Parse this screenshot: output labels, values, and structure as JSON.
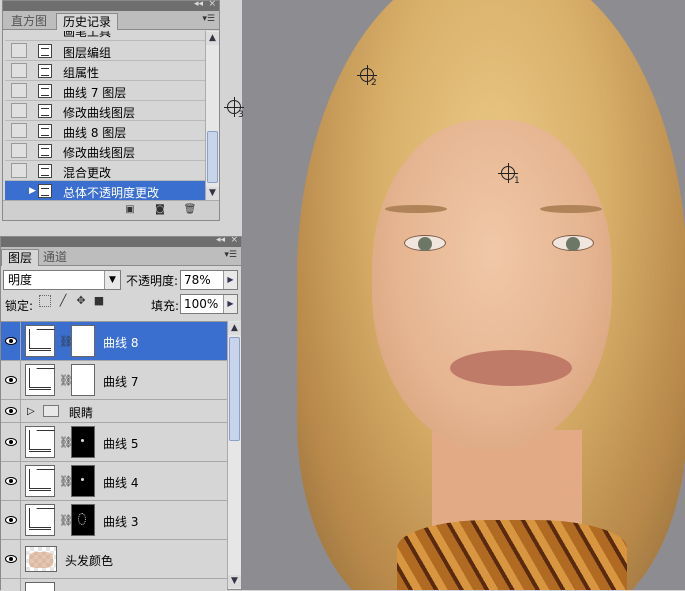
{
  "history_panel": {
    "tabs": [
      {
        "label": "直方图"
      },
      {
        "label": "历史记录"
      }
    ],
    "items": [
      {
        "label": "画笔工具"
      },
      {
        "label": "图层编组"
      },
      {
        "label": "组属性"
      },
      {
        "label": "曲线 7 图层"
      },
      {
        "label": "修改曲线图层"
      },
      {
        "label": "曲线 8 图层"
      },
      {
        "label": "修改曲线图层"
      },
      {
        "label": "混合更改"
      },
      {
        "label": "总体不透明度更改"
      }
    ],
    "selected_index": 8
  },
  "layers_panel": {
    "tabs": [
      {
        "label": "图层"
      },
      {
        "label": "通道"
      }
    ],
    "blend_mode": "明度",
    "opacity_label": "不透明度:",
    "opacity_value": "78%",
    "lock_label": "锁定:",
    "fill_label": "填充:",
    "fill_value": "100%",
    "layers": [
      {
        "name": "曲线 8",
        "type": "curves",
        "mask": "white",
        "selected": true
      },
      {
        "name": "曲线 7",
        "type": "curves",
        "mask": "white",
        "selected": false
      },
      {
        "name": "眼睛",
        "type": "group",
        "selected": false
      },
      {
        "name": "曲线 5",
        "type": "curves",
        "mask": "black",
        "selected": false
      },
      {
        "name": "曲线 4",
        "type": "curves",
        "mask": "black",
        "selected": false
      },
      {
        "name": "曲线 3",
        "type": "curves",
        "mask": "black",
        "selected": false
      },
      {
        "name": "头发颜色",
        "type": "fill",
        "selected": false
      }
    ]
  },
  "canvas": {
    "color_samplers": [
      {
        "label": "1"
      },
      {
        "label": "2"
      },
      {
        "label": "3"
      }
    ]
  },
  "icons": [
    "panel-menu-icon",
    "collapse-icon",
    "close-icon",
    "new-snapshot-icon",
    "camera-icon",
    "trash-icon",
    "eye-icon",
    "chain-icon",
    "folder-icon",
    "lock-transparent-icon",
    "lock-brush-icon",
    "lock-move-icon",
    "lock-all-icon"
  ]
}
